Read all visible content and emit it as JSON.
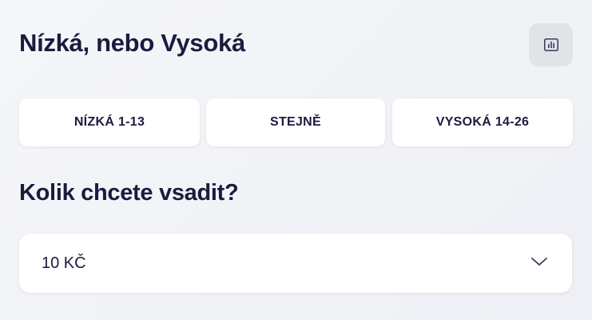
{
  "header": {
    "title": "Nízká, nebo Vysoká",
    "stats_icon": "bar-chart-icon"
  },
  "options": [
    {
      "label": "NÍZKÁ 1-13"
    },
    {
      "label": "STEJNĚ"
    },
    {
      "label": "VYSOKÁ 14-26"
    }
  ],
  "stake": {
    "question": "Kolik chcete vsadit?",
    "selected_value": "10 KČ",
    "dropdown_icon": "chevron-down-icon"
  },
  "colors": {
    "text": "#1c1b3e",
    "background": "#f2f3f7",
    "card": "#ffffff",
    "icon_button_bg": "#e1e3e9"
  }
}
